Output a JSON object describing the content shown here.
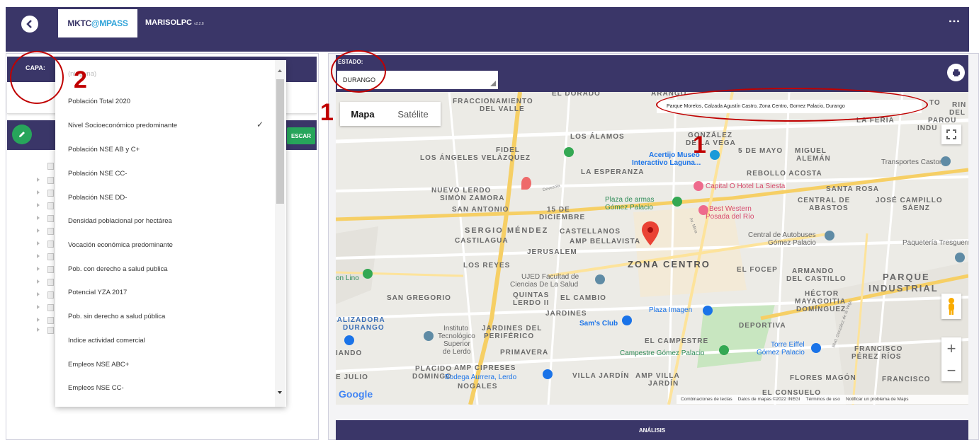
{
  "header": {
    "logo_part1": "MKTC",
    "logo_part2": "MPASS",
    "user": "MARISOLPC",
    "version": "v2.2.8"
  },
  "capa": {
    "label": "CAPA:",
    "placeholder": "(ninguna)",
    "options": [
      "Población Total 2020",
      "Nivel Socioeconómico predominante",
      "Población NSE AB y C+",
      "Población NSE CC-",
      "Población NSE DD-",
      "Densidad poblacional por hectárea",
      "Vocación económica predominante",
      "Pob. con derecho a salud publica",
      "Potencial YZA 2017",
      "Pob. sin derecho a salud pública",
      "Indice actividad comercial",
      "Empleos NSE ABC+",
      "Empleos NSE CC-"
    ],
    "selected_index": 1
  },
  "layers": {
    "escar_label": "ESCAR"
  },
  "estado": {
    "label": "ESTADO:",
    "value": "DURANGO"
  },
  "map": {
    "type_map": "Mapa",
    "type_satellite": "Satélite",
    "address": "Parque Morelos, Calzada Agustín Castro, Zona Centro, Gomez Palacio, Durango",
    "google": "Google",
    "attribution": [
      "Combinaciones de teclas",
      "Datos de mapas ©2022 INEGI",
      "Términos de uso",
      "Notificar un problema de Maps"
    ],
    "labels": {
      "fraccionamiento": "FRACCIONAMIENTO",
      "del_valle": "DEL VALLE",
      "el_dorado": "EL DORADO",
      "arango": "ARANGO",
      "los_alamos": "LOS ÁLAMOS",
      "gonzalez": "GONZÁLEZ",
      "de_la_vega": "DE LA VEGA",
      "la_feria": "LA FERIA",
      "fidel": "FIDEL",
      "los_angeles": "LOS ÁNGELES VELÁZQUEZ",
      "cinco_mayo": "5 DE MAYO",
      "miguel": "MIGUEL",
      "aleman": "ALEMÁN",
      "la_esperanza": "LA ESPERANZA",
      "rebollo": "REBOLLO ACOSTA",
      "nuevo_lerdo": "NUEVO LERDO",
      "simon_zamora": "SIMÓN ZAMORA",
      "san_antonio": "SAN ANTONIO",
      "quince_dic": "15 DE",
      "diciembre": "DICIEMBRE",
      "santa_rosa": "SANTA ROSA",
      "central_de": "CENTRAL DE",
      "abastos": "ABASTOS",
      "jose_campillo": "JOSÉ CAMPILLO",
      "saenz": "SÁENZ",
      "sergio": "SERGIO MÉNDEZ",
      "castellanos": "CASTELLANOS",
      "castilagua": "CASTILAGUA",
      "amp_bellavista": "AMP BELLAVISTA",
      "jerusalem": "JERUSALEM",
      "los_reyes": "LOS REYES",
      "zona_centro": "ZONA CENTRO",
      "el_focep": "EL FOCEP",
      "armando": "ARMANDO",
      "del_castillo": "DEL CASTILLO",
      "parque": "PARQUE",
      "industrial": "INDUSTRIAL",
      "san_gregorio": "SAN GREGORIO",
      "quintas": "QUINTAS",
      "lerdo_ii": "LERDO II",
      "el_cambio": "EL CAMBIO",
      "hector": "HÉCTOR",
      "mayagoitia": "MAYAGOITIA",
      "dominguez": "DOMÍNGUEZ",
      "jardines": "JARDINES",
      "jardines_del": "JARDINES DEL",
      "periferico": "PERIFÉRICO",
      "deportiva": "DEPORTIVA",
      "el_campestre": "EL CAMPESTRE",
      "primavera": "PRIMAVERA",
      "francisco": "FRANCISCO",
      "perez_rios": "PÉREZ RÍOS",
      "placido": "PLACIDO",
      "domingo": "DOMINGO",
      "amp_cipreses": "AMP CIPRESES",
      "nogales": "NOGALES",
      "villa_jardin": "VILLA JARDÍN",
      "amp_villa": "AMP VILLA",
      "jardin": "JARDÍN",
      "flores_magon": "FLORES MAGÓN",
      "francisco2": "FRANCISCO",
      "el_consuelo": "EL CONSUELO",
      "ializadora": "IALIZADORA",
      "durango": "DURANGO",
      "iando": "IANDO",
      "julio": "E JULIO",
      "indu": "INDU",
      "p_arou": "PAROU",
      "rin": "RIN",
      "del2": "DEL",
      "to": "TO"
    },
    "pois": {
      "acertijo": "Acertijo Museo",
      "interactivo": "Interactivo Laguna...",
      "capital_o": "Capital O Hotel La Siesta",
      "plaza_armas": "Plaza de armas",
      "gomez_palacio": "Gómez Palacio",
      "best_western": "Best Western",
      "posada": "Posada del Río",
      "central_autobuses": "Central de Autobuses",
      "gomez_palacio2": "Gómez Palacio",
      "transportes": "Transportes Castores",
      "paqueteria": "Paquetería Tresguerra",
      "ujed": "UJED Facultad de",
      "ciencias": "Ciencias De La Salud",
      "plaza_imagen": "Plaza Imagen",
      "sams": "Sam's Club",
      "instituto": "Instituto",
      "tecnologico": "Tecnológico",
      "superior": "Superior",
      "de_lerdo": "de Lerdo",
      "campestre": "Campestre Gómez Palacio",
      "torre_eiffel": "Torre Eiffel",
      "gomez_palacio3": "Gómez Palacio",
      "bodega": "Bodega Aurrera, Lerdo",
      "on_lino": "on Lino",
      "devesola": "Devesola",
      "av_mina": "Av. Mina",
      "blvd": "Blvd. González de la Vega"
    }
  },
  "analisis": {
    "label": "ANÁLISIS"
  },
  "annotations": [
    "1",
    "2",
    "1"
  ],
  "colors": {
    "header": "#3a3668",
    "accent_green": "#27a55b",
    "annotation_red": "#c00000"
  }
}
